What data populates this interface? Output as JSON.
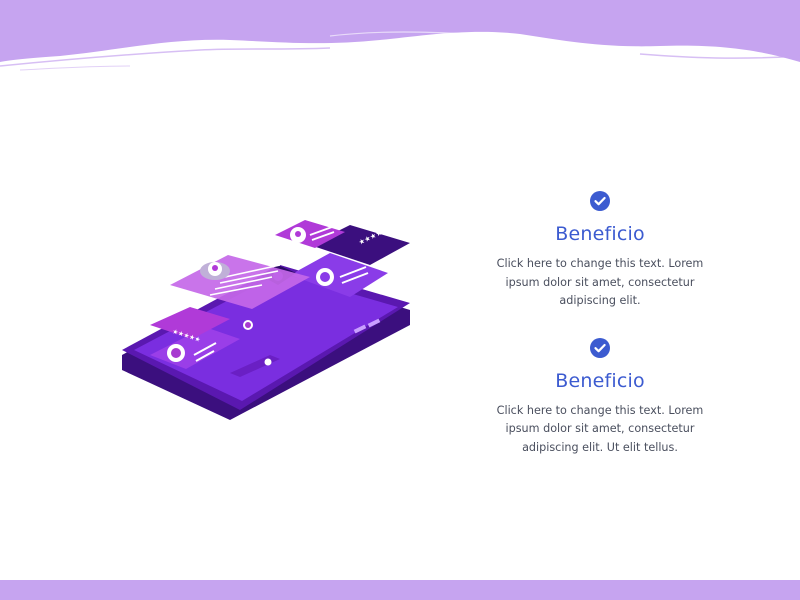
{
  "colors": {
    "lavender": "#c6a4f0",
    "accent_blue": "#3c5bd0",
    "text_gray": "#4a4f5e",
    "white": "#ffffff",
    "phone_dark": "#3b0f7e",
    "phone_purple": "#6a1fc4",
    "card_magenta": "#a83ad0",
    "card_violet": "#7c2ee0"
  },
  "benefits": [
    {
      "icon": "check-circle-icon",
      "title": "Beneficio",
      "text": "Click here to change this text. Lorem ipsum dolor sit amet, consectetur adipiscing elit."
    },
    {
      "icon": "check-circle-icon",
      "title": "Beneficio",
      "text": "Click here to change this text. Lorem ipsum dolor sit amet, consectetur adipiscing elit. Ut elit tellus."
    }
  ],
  "illustration": {
    "icon": "smartphone-chat-illustration",
    "rating_stars": "★★★★★"
  }
}
